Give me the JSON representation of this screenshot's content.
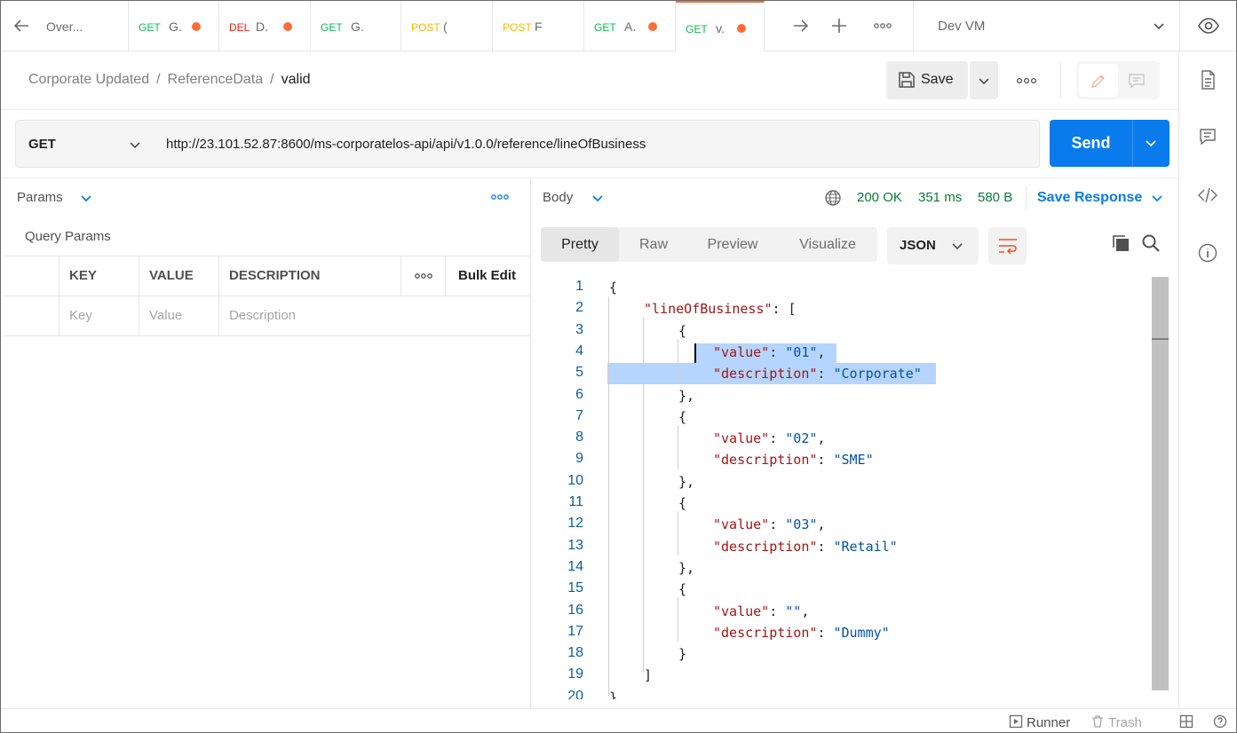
{
  "tabbar": {
    "tabs": [
      {
        "method": "",
        "name": "Over...",
        "dirty": false,
        "active": false
      },
      {
        "method": "GET",
        "name": "G.",
        "dirty": true,
        "active": false
      },
      {
        "method": "DEL",
        "name": "D.",
        "dirty": true,
        "active": false
      },
      {
        "method": "GET",
        "name": "G.",
        "dirty": false,
        "active": false
      },
      {
        "method": "POST",
        "name": "(",
        "dirty": false,
        "active": false
      },
      {
        "method": "POST",
        "name": "F",
        "dirty": false,
        "active": false
      },
      {
        "method": "GET",
        "name": "A.",
        "dirty": true,
        "active": false
      },
      {
        "method": "GET",
        "name": "v.",
        "dirty": true,
        "active": true
      }
    ],
    "environment": "Dev VM"
  },
  "breadcrumb": {
    "collection": "Corporate Updated",
    "folder": "ReferenceData",
    "request": "valid",
    "separator": "/"
  },
  "toolbar": {
    "save_label": "Save"
  },
  "request": {
    "method": "GET",
    "url": "http://23.101.52.87:8600/ms-corporatelos-api/api/v1.0.0/reference/lineOfBusiness",
    "send_label": "Send"
  },
  "params": {
    "header": "Params",
    "section_title": "Query Params",
    "columns": [
      "KEY",
      "VALUE",
      "DESCRIPTION"
    ],
    "bulk_edit": "Bulk Edit",
    "placeholders": {
      "key": "Key",
      "value": "Value",
      "description": "Description"
    }
  },
  "response": {
    "body_label": "Body",
    "status": "200 OK",
    "time": "351 ms",
    "size": "580 B",
    "save_response": "Save Response",
    "view_tabs": [
      "Pretty",
      "Raw",
      "Preview",
      "Visualize"
    ],
    "active_view": "Pretty",
    "format": "JSON",
    "lines": [
      {
        "n": "1",
        "indent": 0,
        "parts": [
          [
            "p",
            "{"
          ]
        ]
      },
      {
        "n": "2",
        "indent": 1,
        "parts": [
          [
            "k",
            "\"lineOfBusiness\""
          ],
          [
            "p",
            ": ["
          ]
        ]
      },
      {
        "n": "3",
        "indent": 2,
        "parts": [
          [
            "p",
            "{"
          ]
        ]
      },
      {
        "n": "4",
        "indent": 3,
        "parts": [
          [
            "k",
            "\"value\""
          ],
          [
            "p",
            ": "
          ],
          [
            "s",
            "\"01\""
          ],
          [
            "p",
            ","
          ]
        ]
      },
      {
        "n": "5",
        "indent": 3,
        "parts": [
          [
            "k",
            "\"description\""
          ],
          [
            "p",
            ": "
          ],
          [
            "s",
            "\"Corporate\""
          ]
        ]
      },
      {
        "n": "6",
        "indent": 2,
        "parts": [
          [
            "p",
            "},"
          ]
        ]
      },
      {
        "n": "7",
        "indent": 2,
        "parts": [
          [
            "p",
            "{"
          ]
        ]
      },
      {
        "n": "8",
        "indent": 3,
        "parts": [
          [
            "k",
            "\"value\""
          ],
          [
            "p",
            ": "
          ],
          [
            "s",
            "\"02\""
          ],
          [
            "p",
            ","
          ]
        ]
      },
      {
        "n": "9",
        "indent": 3,
        "parts": [
          [
            "k",
            "\"description\""
          ],
          [
            "p",
            ": "
          ],
          [
            "s",
            "\"SME\""
          ]
        ]
      },
      {
        "n": "10",
        "indent": 2,
        "parts": [
          [
            "p",
            "},"
          ]
        ]
      },
      {
        "n": "11",
        "indent": 2,
        "parts": [
          [
            "p",
            "{"
          ]
        ]
      },
      {
        "n": "12",
        "indent": 3,
        "parts": [
          [
            "k",
            "\"value\""
          ],
          [
            "p",
            ": "
          ],
          [
            "s",
            "\"03\""
          ],
          [
            "p",
            ","
          ]
        ]
      },
      {
        "n": "13",
        "indent": 3,
        "parts": [
          [
            "k",
            "\"description\""
          ],
          [
            "p",
            ": "
          ],
          [
            "s",
            "\"Retail\""
          ]
        ]
      },
      {
        "n": "14",
        "indent": 2,
        "parts": [
          [
            "p",
            "},"
          ]
        ]
      },
      {
        "n": "15",
        "indent": 2,
        "parts": [
          [
            "p",
            "{"
          ]
        ]
      },
      {
        "n": "16",
        "indent": 3,
        "parts": [
          [
            "k",
            "\"value\""
          ],
          [
            "p",
            ": "
          ],
          [
            "s",
            "\"\""
          ],
          [
            "p",
            ","
          ]
        ]
      },
      {
        "n": "17",
        "indent": 3,
        "parts": [
          [
            "k",
            "\"description\""
          ],
          [
            "p",
            ": "
          ],
          [
            "s",
            "\"Dummy\""
          ]
        ]
      },
      {
        "n": "18",
        "indent": 2,
        "parts": [
          [
            "p",
            "}"
          ]
        ]
      },
      {
        "n": "19",
        "indent": 1,
        "parts": [
          [
            "p",
            "]"
          ]
        ]
      },
      {
        "n": "20",
        "indent": 0,
        "parts": [
          [
            "p",
            "}"
          ]
        ]
      }
    ]
  },
  "statusbar": {
    "runner": "Runner",
    "trash": "Trash"
  },
  "colors": {
    "accent": "#097bed",
    "tab_active": "#ff6c37",
    "get": "#0cbb52",
    "delete": "#eb2013",
    "post": "#ffb400",
    "status_ok": "#0a7c34",
    "selection": "#b5d5ff"
  }
}
